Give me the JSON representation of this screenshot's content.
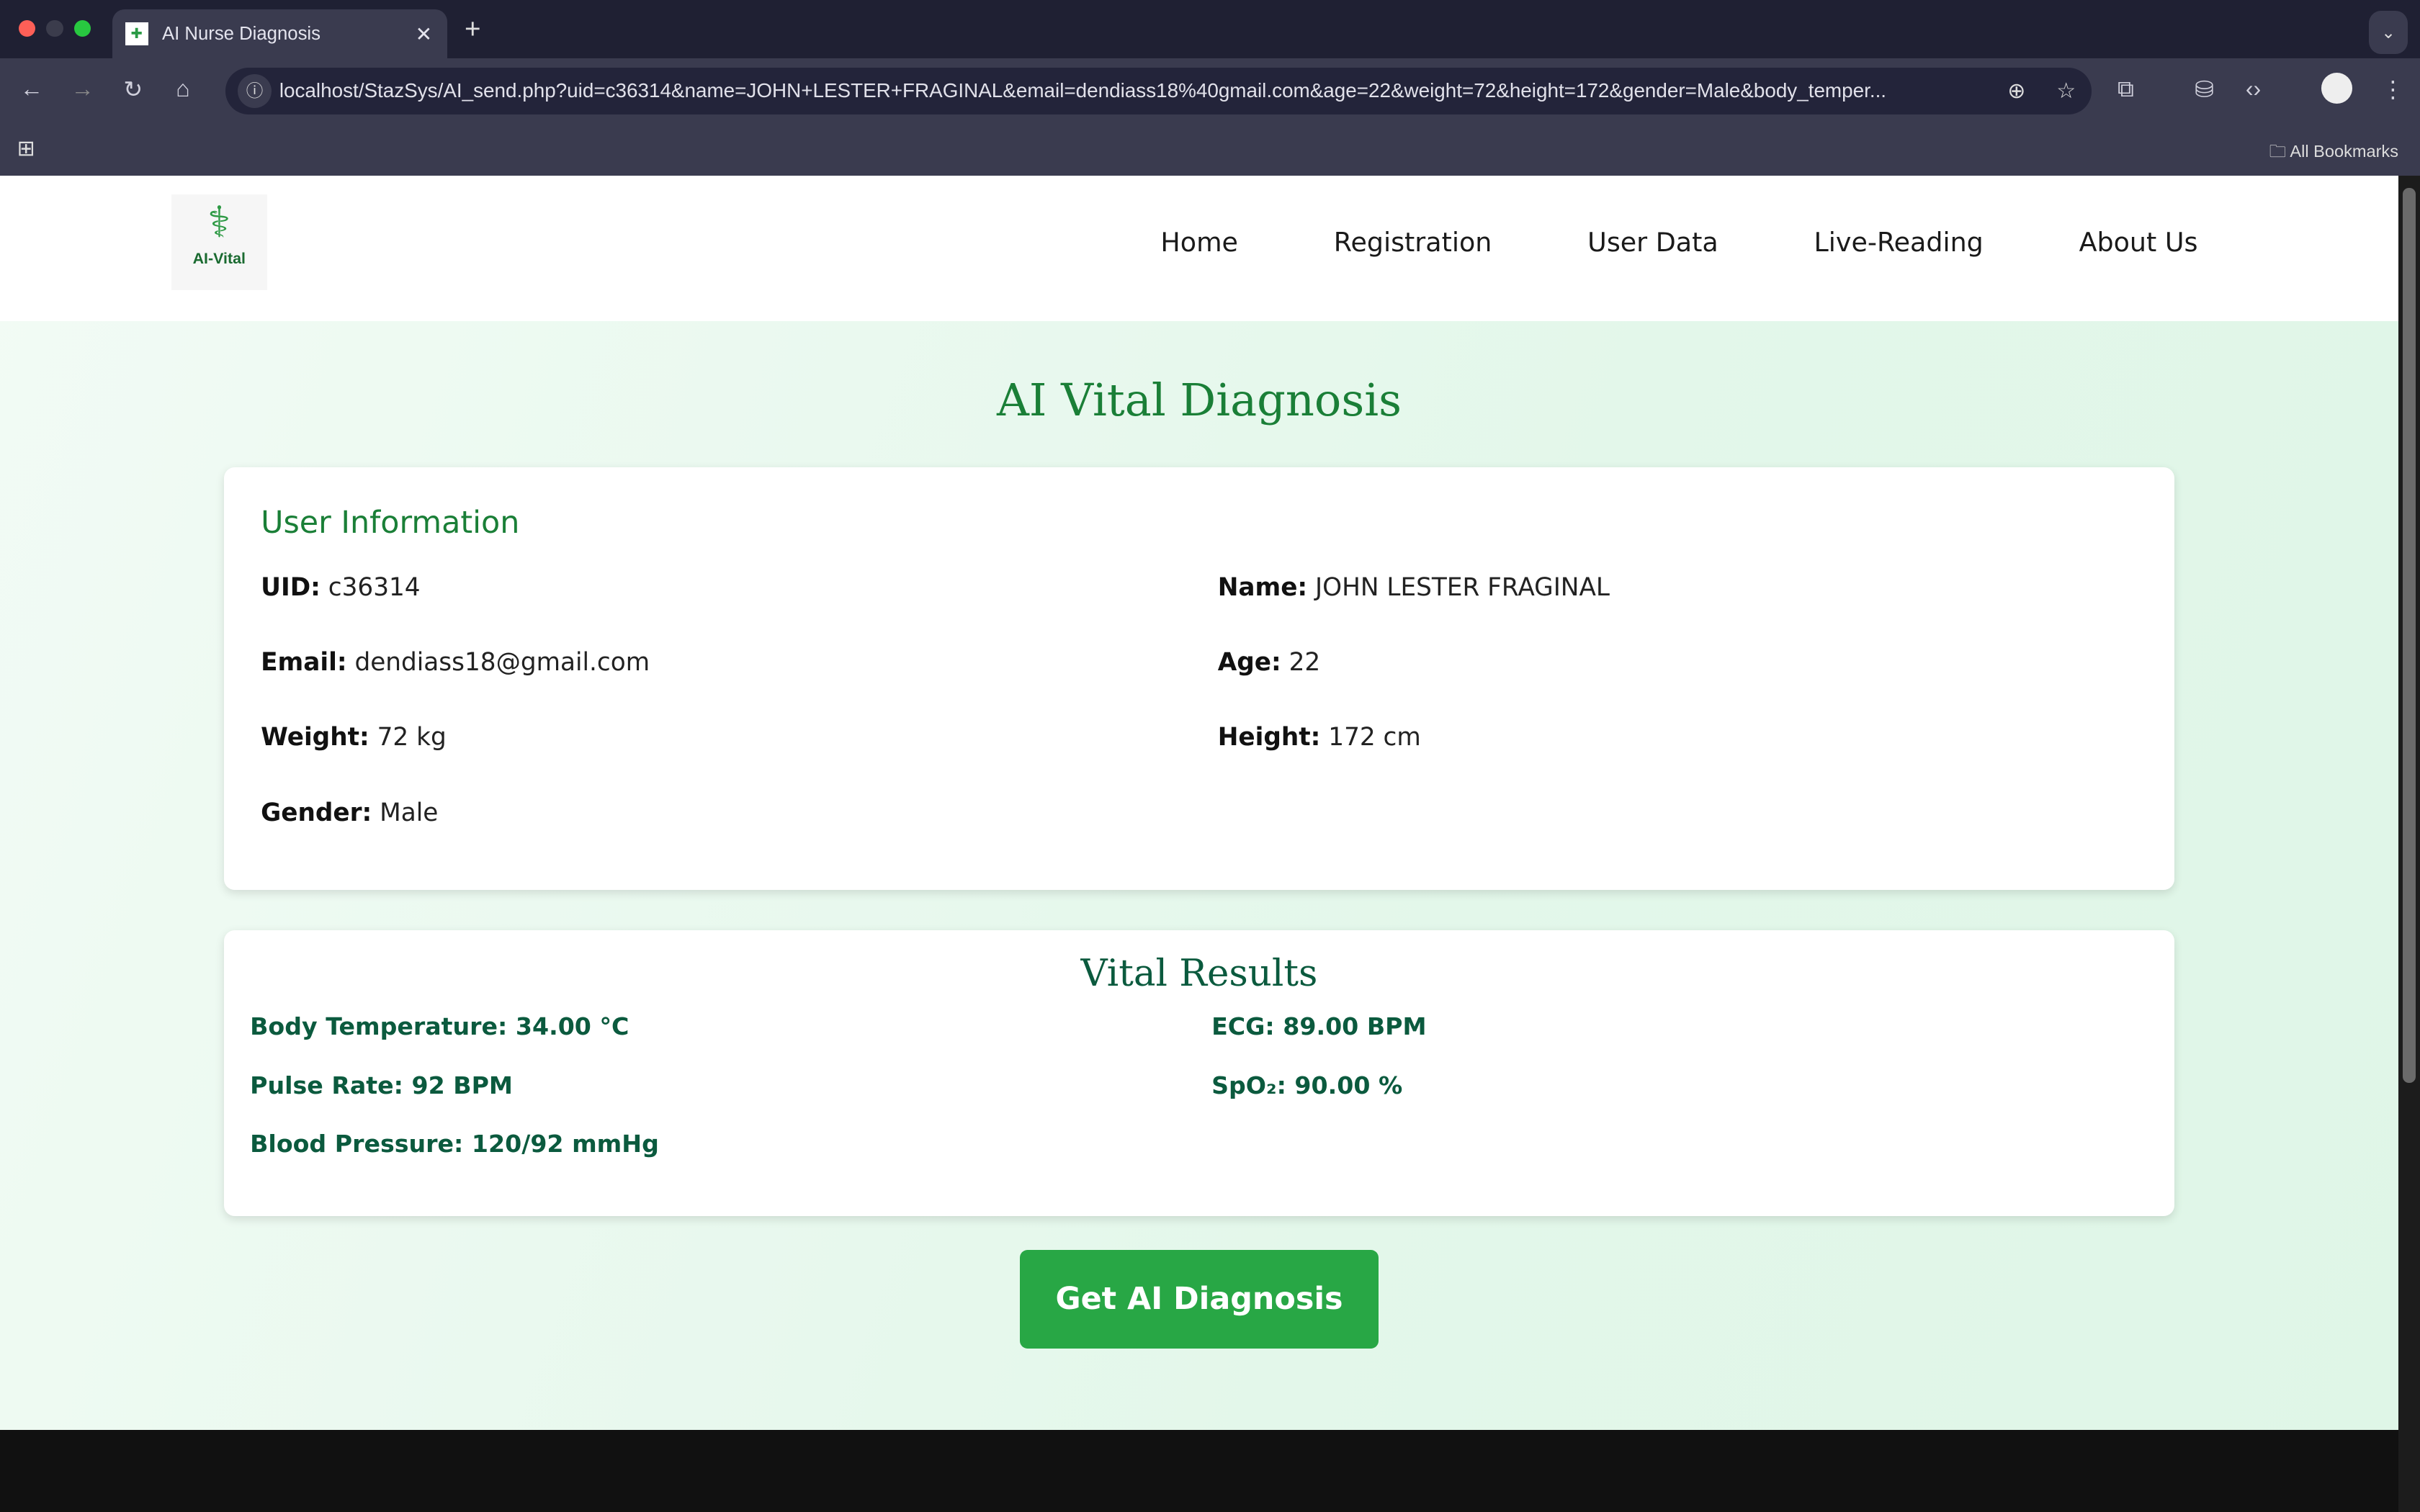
{
  "browser": {
    "tab_title": "AI Nurse Diagnosis",
    "url": "localhost/StazSys/AI_send.php?uid=c36314&name=JOHN+LESTER+FRAGINAL&email=dendiass18%40gmail.com&age=22&weight=72&height=172&gender=Male&body_temper...",
    "bookmarks_label": "All Bookmarks"
  },
  "site": {
    "logo_text": "AI-Vital",
    "nav": [
      "Home",
      "Registration",
      "User Data",
      "Live-Reading",
      "About Us"
    ]
  },
  "page_title": "AI Vital Diagnosis",
  "user_info": {
    "heading": "User Information",
    "uid_label": "UID:",
    "uid": "c36314",
    "name_label": "Name:",
    "name": "JOHN LESTER FRAGINAL",
    "email_label": "Email:",
    "email": "dendiass18@gmail.com",
    "age_label": "Age:",
    "age": "22",
    "weight_label": "Weight:",
    "weight": "72 kg",
    "height_label": "Height:",
    "height": "172 cm",
    "gender_label": "Gender:",
    "gender": "Male"
  },
  "vitals": {
    "heading": "Vital Results",
    "body_temp": "Body Temperature: 34.00 °C",
    "ecg": "ECG: 89.00 BPM",
    "pulse": "Pulse Rate: 92 BPM",
    "spo2": "SpO₂: 90.00 %",
    "bp": "Blood Pressure: 120/92 mmHg"
  },
  "button": "Get AI Diagnosis"
}
